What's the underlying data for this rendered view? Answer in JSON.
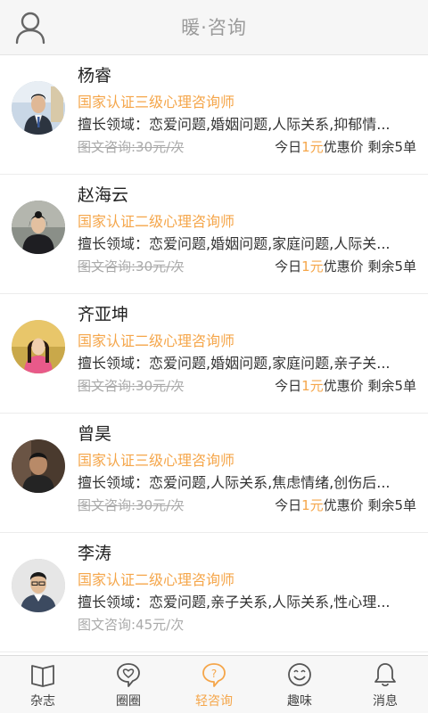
{
  "header": {
    "title": "暖·咨询",
    "user_icon": "user-icon"
  },
  "colors": {
    "accent": "#f5a64a",
    "text": "#333333",
    "muted": "#aaaaaa",
    "header_bg": "#f6f6f6"
  },
  "counselors": [
    {
      "name": "杨睿",
      "cert": "国家认证三级心理咨询师",
      "specialty": "擅长领域：恋爱问题,婚姻问题,人际关系,抑郁情...",
      "price": "图文咨询:30元/次",
      "promo_prefix": "今日",
      "promo_amount": "1元",
      "promo_suffix": "优惠价",
      "remaining": "剩余5单"
    },
    {
      "name": "赵海云",
      "cert": "国家认证二级心理咨询师",
      "specialty": "擅长领域：恋爱问题,婚姻问题,家庭问题,人际关...",
      "price": "图文咨询:30元/次",
      "promo_prefix": "今日",
      "promo_amount": "1元",
      "promo_suffix": "优惠价",
      "remaining": "剩余5单"
    },
    {
      "name": "齐亚坤",
      "cert": "国家认证二级心理咨询师",
      "specialty": "擅长领域：恋爱问题,婚姻问题,家庭问题,亲子关...",
      "price": "图文咨询:30元/次",
      "promo_prefix": "今日",
      "promo_amount": "1元",
      "promo_suffix": "优惠价",
      "remaining": "剩余5单"
    },
    {
      "name": "曾昊",
      "cert": "国家认证三级心理咨询师",
      "specialty": "擅长领域：恋爱问题,人际关系,焦虑情绪,创伤后...",
      "price": "图文咨询:30元/次",
      "promo_prefix": "今日",
      "promo_amount": "1元",
      "promo_suffix": "优惠价",
      "remaining": "剩余5单"
    },
    {
      "name": "李涛",
      "cert": "国家认证二级心理咨询师",
      "specialty": "擅长领域：恋爱问题,亲子关系,人际关系,性心理...",
      "price": "图文咨询:45元/次"
    }
  ],
  "tabs": [
    {
      "label": "杂志",
      "icon": "book-icon"
    },
    {
      "label": "圈圈",
      "icon": "heart-chat-icon"
    },
    {
      "label": "轻咨询",
      "icon": "question-icon",
      "active": true
    },
    {
      "label": "趣味",
      "icon": "smile-icon"
    },
    {
      "label": "消息",
      "icon": "bell-icon"
    }
  ]
}
